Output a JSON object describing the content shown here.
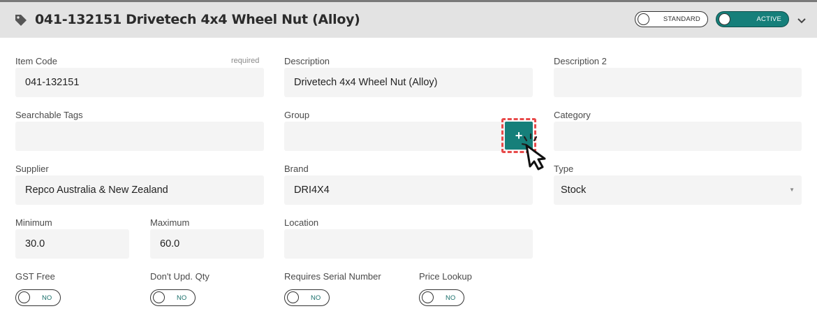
{
  "header": {
    "title": "041-132151 Drivetech 4x4 Wheel Nut (Alloy)",
    "standard_label": "STANDARD",
    "active_label": "ACTIVE"
  },
  "form": {
    "item_code": {
      "label": "Item Code",
      "required": "required",
      "value": "041-132151"
    },
    "description": {
      "label": "Description",
      "value": "Drivetech 4x4 Wheel Nut (Alloy)"
    },
    "description2": {
      "label": "Description 2",
      "value": ""
    },
    "searchable_tags": {
      "label": "Searchable Tags",
      "value": ""
    },
    "group": {
      "label": "Group",
      "value": ""
    },
    "category": {
      "label": "Category",
      "value": ""
    },
    "supplier": {
      "label": "Supplier",
      "value": "Repco Australia & New Zealand"
    },
    "brand": {
      "label": "Brand",
      "value": "DRI4X4"
    },
    "type": {
      "label": "Type",
      "value": "Stock"
    },
    "minimum": {
      "label": "Minimum",
      "value": "30.0"
    },
    "maximum": {
      "label": "Maximum",
      "value": "60.0"
    },
    "location": {
      "label": "Location",
      "value": ""
    },
    "gst_free": {
      "label": "GST Free",
      "state": "NO"
    },
    "dont_upd_qty": {
      "label": "Don't Upd. Qty",
      "state": "NO"
    },
    "requires_serial": {
      "label": "Requires Serial Number",
      "state": "NO"
    },
    "price_lookup": {
      "label": "Price Lookup",
      "state": "NO"
    }
  },
  "add_group_button": {
    "label": "+"
  },
  "colors": {
    "accent": "#167f7a",
    "highlight": "#e84a4a",
    "field_bg": "#f4f4f4",
    "header_bg": "#e3e3e3"
  },
  "icons": {
    "tag": "tag-icon",
    "chevron": "chevron-down-icon",
    "cursor": "pointer-cursor-icon"
  }
}
